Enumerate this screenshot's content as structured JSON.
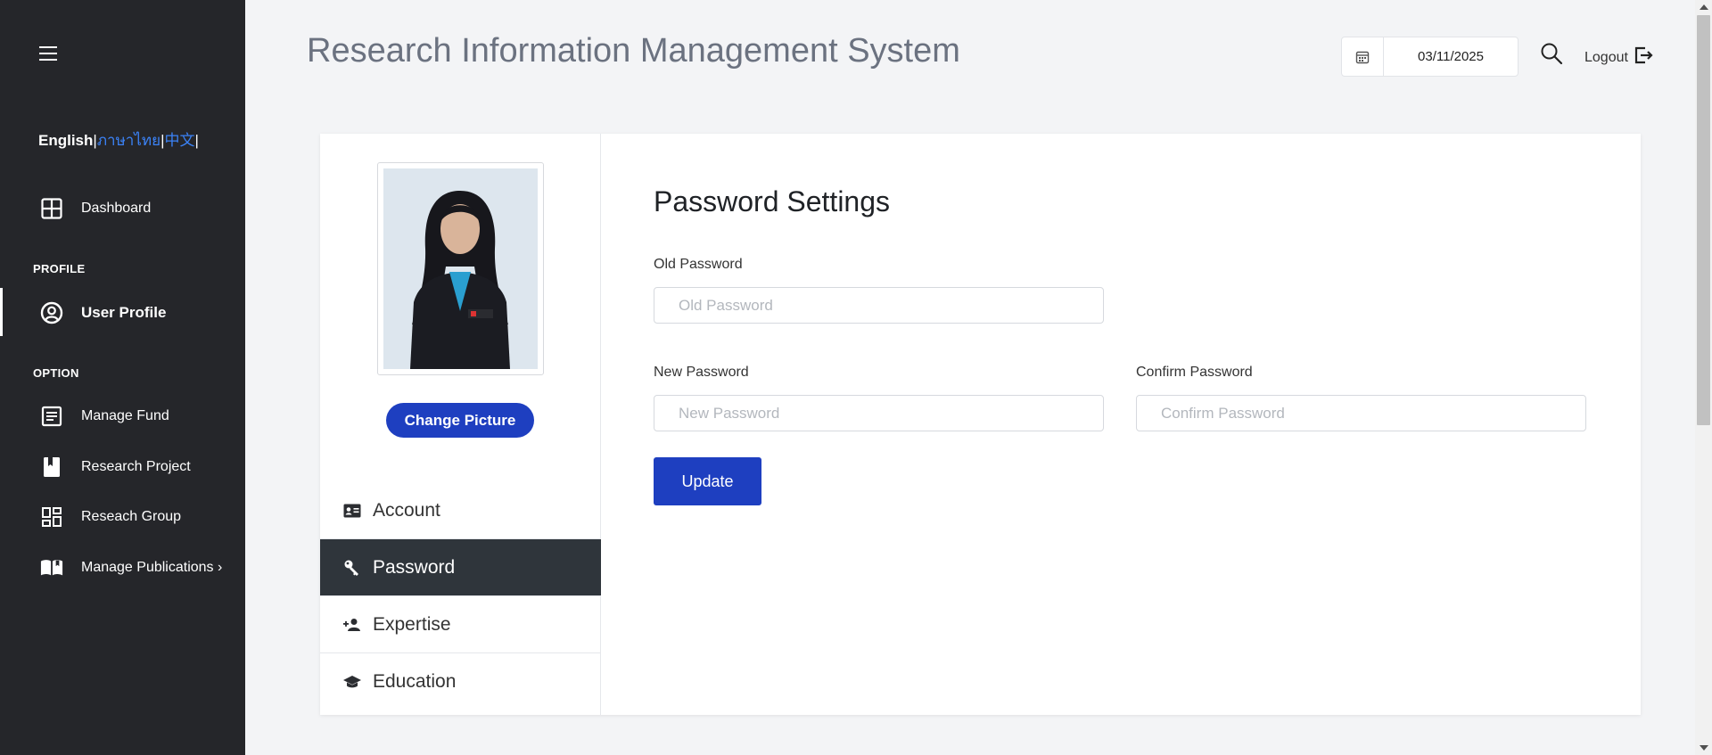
{
  "sidebar": {
    "languages": {
      "english": "English",
      "separator": "|",
      "thai": "ภาษาไทย",
      "chinese": "中文"
    },
    "dashboard_label": "Dashboard",
    "profile_header": "PROFILE",
    "user_profile_label": "User Profile",
    "option_header": "OPTION",
    "items": [
      {
        "label": "Manage Fund",
        "icon": "document-list-icon"
      },
      {
        "label": "Research Project",
        "icon": "bookmark-book-icon"
      },
      {
        "label": "Reseach Group",
        "icon": "dashboard-grid-icon"
      },
      {
        "label": "Manage Publications",
        "icon": "open-book-icon",
        "chevron": "›"
      }
    ]
  },
  "header": {
    "title": "Research Information Management System",
    "date": "03/11/2025",
    "logout_label": "Logout"
  },
  "profile": {
    "change_picture_label": "Change Picture",
    "tabs": [
      {
        "label": "Account",
        "icon": "id-card-icon",
        "active": false
      },
      {
        "label": "Password",
        "icon": "key-icon",
        "active": true
      },
      {
        "label": "Expertise",
        "icon": "person-add-icon",
        "active": false
      },
      {
        "label": "Education",
        "icon": "graduation-cap-icon",
        "active": false
      }
    ]
  },
  "form": {
    "title": "Password Settings",
    "old_password_label": "Old Password",
    "old_password_placeholder": "Old Password",
    "new_password_label": "New Password",
    "new_password_placeholder": "New Password",
    "confirm_password_label": "Confirm Password",
    "confirm_password_placeholder": "Confirm Password",
    "update_label": "Update"
  },
  "colors": {
    "sidebar_bg": "#25262a",
    "primary": "#1e3fc0",
    "active_tab": "#2f353b",
    "link_blue": "#3b82f6"
  }
}
